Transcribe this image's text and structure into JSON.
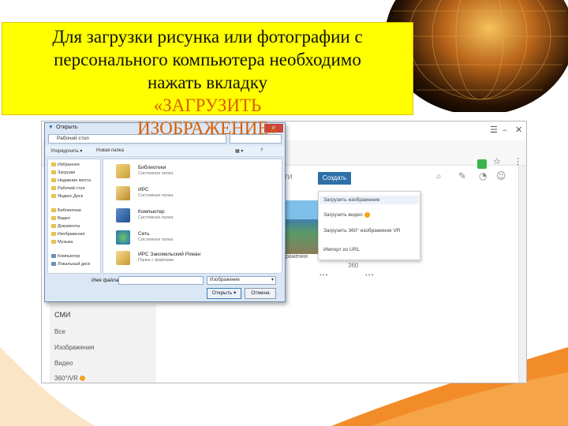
{
  "caption": {
    "line1": "Для загрузки рисунка или фотографии с",
    "line2": "персонального компьютера необходимо",
    "line3_a": "нажать вкладку ",
    "line3_b": "«ЗАГРУЗИТЬ",
    "line4": "ИЗОБРАЖЕНИЕ»"
  },
  "web": {
    "nav_news_fragment": "ВОСТИ",
    "create_button": "Создать",
    "menu_items": [
      "Загрузить изображение",
      "Загрузить видео",
      "Загрузить 360° изображение VR",
      "Импорт из URL"
    ],
    "sidebar": {
      "smi": "СМИ",
      "all": "Все",
      "images": "Изображения",
      "video": "Видео",
      "three60": "360°/VR"
    },
    "card_caption_fragment": "изображения",
    "card_360": "360"
  },
  "dialog": {
    "title": "Открыть",
    "path": "Рабочий стол",
    "toolbar": {
      "organize": "Упорядочить ▾",
      "new_folder": "Новая папка"
    },
    "nav": [
      {
        "label": "Избранное",
        "icon": "star-icon"
      },
      {
        "label": "Загрузки",
        "icon": "folder-icon"
      },
      {
        "label": "Недавние места",
        "icon": "folder-icon"
      },
      {
        "label": "Рабочий стол",
        "icon": "folder-icon"
      },
      {
        "label": "Яндекс.Диск",
        "icon": "folder-icon"
      },
      {
        "label": "Библиотеки",
        "icon": "library-icon"
      },
      {
        "label": "Видео",
        "icon": "folder-icon"
      },
      {
        "label": "Документы",
        "icon": "folder-icon"
      },
      {
        "label": "Изображения",
        "icon": "folder-icon"
      },
      {
        "label": "Музыка",
        "icon": "folder-icon"
      },
      {
        "label": "Компьютер",
        "icon": "computer-icon"
      },
      {
        "label": "Локальный диск",
        "icon": "disk-icon"
      }
    ],
    "files": [
      {
        "name": "Библиотеки",
        "sub": "Системная папка",
        "icon": "library-icon"
      },
      {
        "name": "ИРС",
        "sub": "Системная папка",
        "icon": "user-folder-icon"
      },
      {
        "name": "Компьютер",
        "sub": "Системная папка",
        "icon": "computer-icon"
      },
      {
        "name": "Сеть",
        "sub": "Системная папка",
        "icon": "network-icon"
      },
      {
        "name": "ИРС Закомельский Роман",
        "sub": "Папка с файлами",
        "icon": "folder-icon"
      }
    ],
    "filename_label": "Имя файла:",
    "filetype": "Изображение",
    "open_button": "Открыть",
    "cancel_button": "Отмена"
  },
  "colors": {
    "caption_bg": "#ffff00",
    "accent": "#d95e00",
    "create_button": "#2d6fa8"
  }
}
